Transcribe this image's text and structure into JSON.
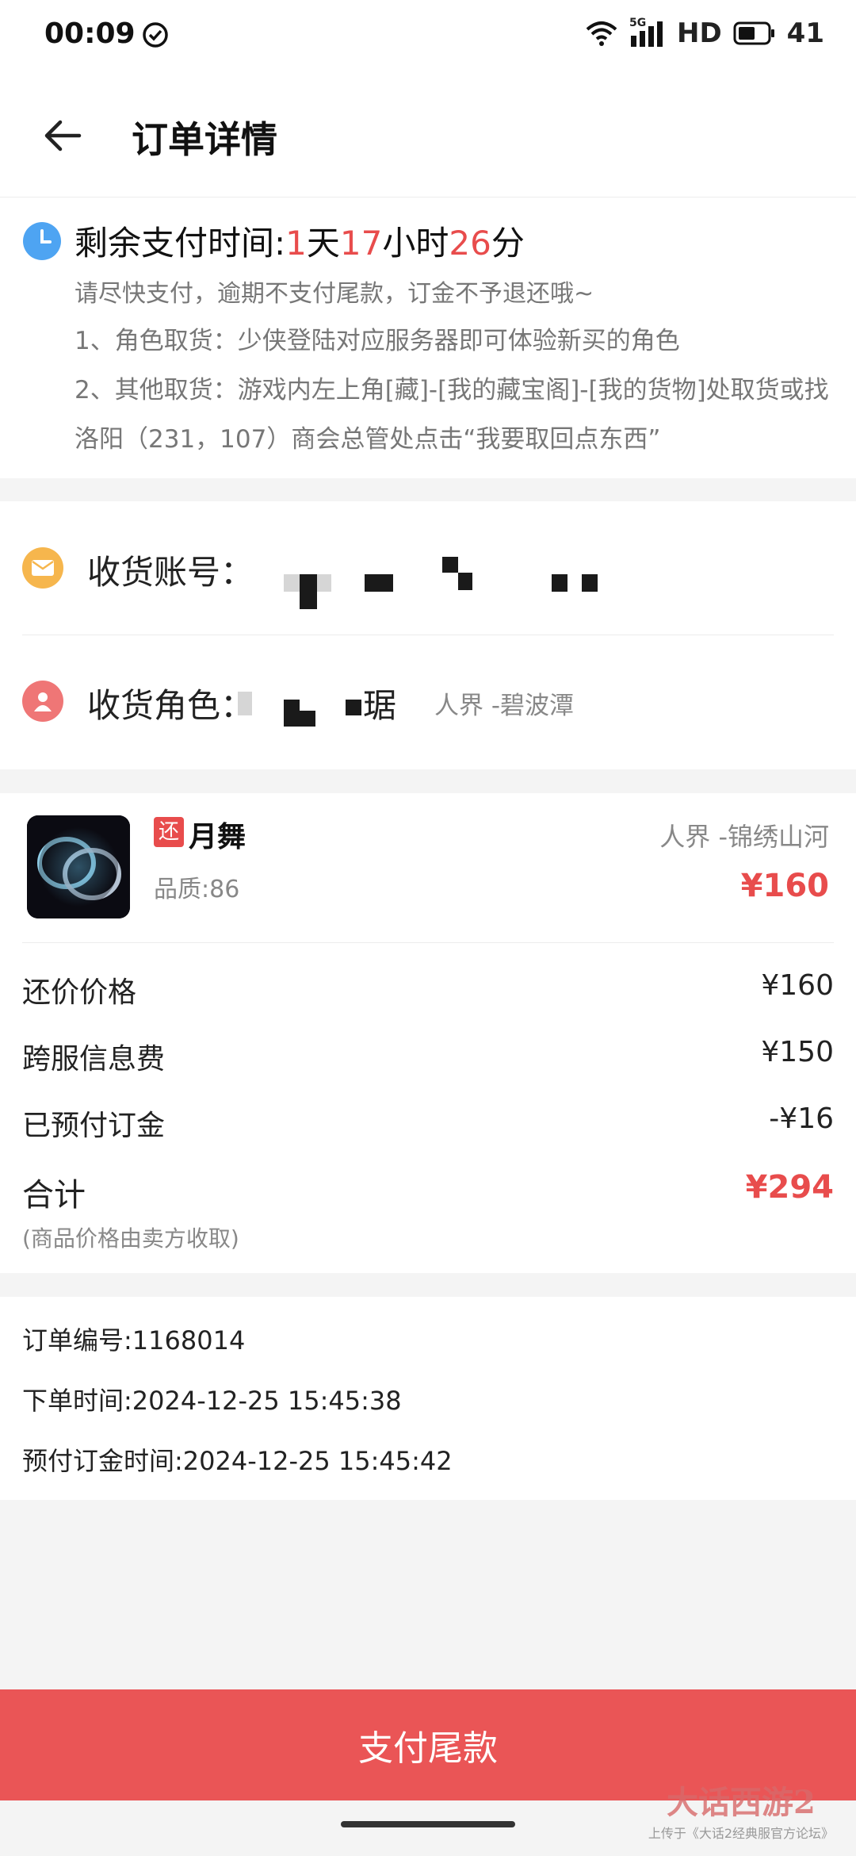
{
  "status_bar": {
    "time": "00:09",
    "network": "5G",
    "hd": "HD",
    "battery": "41"
  },
  "header": {
    "title": "订单详情"
  },
  "countdown": {
    "label": "剩余支付时间:",
    "days": "1",
    "days_unit": "天",
    "hours": "17",
    "hours_unit": "小时",
    "minutes": "26",
    "minutes_unit": "分",
    "notice": "请尽快支付，逾期不支付尾款，订金不予退还哦~",
    "rule1": "1、角色取货：少侠登陆对应服务器即可体验新买的角色",
    "rule2": "2、其他取货：游戏内左上角[藏]-[我的藏宝阁]-[我的货物]处取货或找洛阳（231，107）商会总管处点击“我要取回点东西”"
  },
  "receive": {
    "account_label": "收货账号：",
    "role_label": "收货角色：",
    "role_suffix": "琚",
    "role_server": "人界 -碧波潭"
  },
  "product": {
    "tag": "还",
    "name": "月舞",
    "quality": "品质:86",
    "server": "人界 -锦绣山河",
    "price": "¥160"
  },
  "fees": {
    "counter_price_label": "还价价格",
    "counter_price": "¥160",
    "cross_server_label": "跨服信息费",
    "cross_server": "¥150",
    "deposit_label": "已预付订金",
    "deposit": "-¥16",
    "total_label": "合计",
    "total": "¥294",
    "note": "(商品价格由卖方收取)"
  },
  "order": {
    "number": "订单编号:1168014",
    "created": "下单时间:2024-12-25 15:45:38",
    "deposit_time": "预付订金时间:2024-12-25 15:45:42"
  },
  "actions": {
    "pay_label": "支付尾款"
  },
  "watermark": {
    "logo": "大话西游2",
    "sub": "上传于《大话2经典服官方论坛》"
  },
  "colors": {
    "accent": "#e84c4c",
    "pay_bar": "#ea5556",
    "clock": "#4ea4f2",
    "mail": "#f6b64d",
    "user": "#ef7676"
  },
  "icons": [
    "check-circle-icon",
    "wifi-icon",
    "signal-icon",
    "battery-icon",
    "back-arrow-icon",
    "clock-icon",
    "mail-icon",
    "user-icon"
  ]
}
